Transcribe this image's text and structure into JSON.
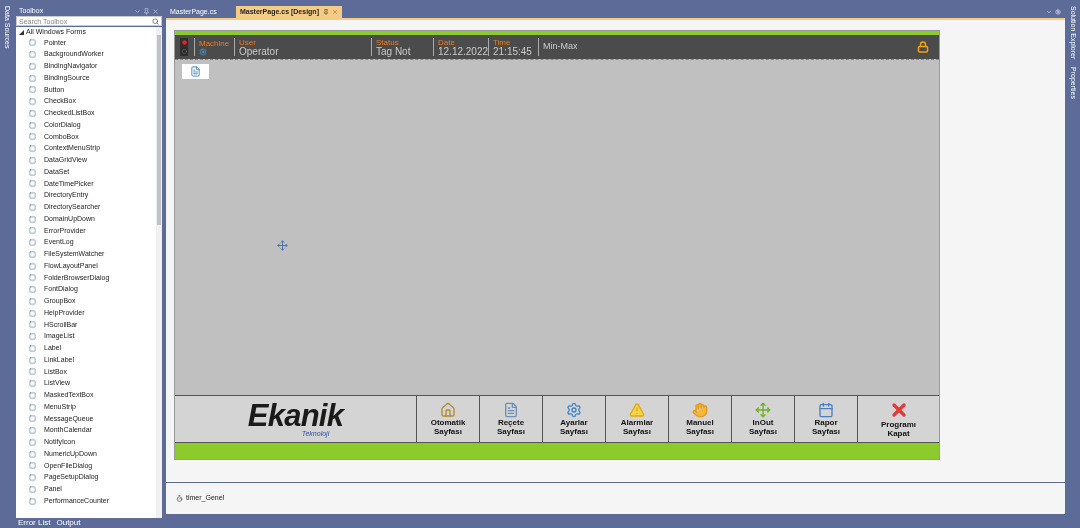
{
  "left_strip": {
    "label": "Data Sources"
  },
  "toolbox": {
    "title": "Toolbox",
    "search_placeholder": "Search Toolbox",
    "category": {
      "label": "All Windows Forms",
      "expanded": true
    },
    "items": [
      "Pointer",
      "BackgroundWorker",
      "BindingNavigator",
      "BindingSource",
      "Button",
      "CheckBox",
      "CheckedListBox",
      "ColorDialog",
      "ComboBox",
      "ContextMenuStrip",
      "DataGridView",
      "DataSet",
      "DateTimePicker",
      "DirectoryEntry",
      "DirectorySearcher",
      "DomainUpDown",
      "ErrorProvider",
      "EventLog",
      "FileSystemWatcher",
      "FlowLayoutPanel",
      "FolderBrowserDialog",
      "FontDialog",
      "GroupBox",
      "HelpProvider",
      "HScrollBar",
      "ImageList",
      "Label",
      "LinkLabel",
      "ListBox",
      "ListView",
      "MaskedTextBox",
      "MenuStrip",
      "MessageQueue",
      "MonthCalendar",
      "NotifyIcon",
      "NumericUpDown",
      "OpenFileDialog",
      "PageSetupDialog",
      "Panel",
      "PerformanceCounter"
    ]
  },
  "tabs": [
    {
      "label": "MasterPage.cs",
      "selected": false
    },
    {
      "label": "MasterPage.cs [Design]",
      "selected": true
    }
  ],
  "form": {
    "header": [
      {
        "kind": "icon",
        "label": "Machine"
      },
      {
        "kind": "text",
        "label": "User",
        "value": "Operator"
      },
      {
        "kind": "text",
        "label": "Status",
        "value": "Tag Not"
      },
      {
        "kind": "text",
        "label": "Date",
        "value": "12.12.2022"
      },
      {
        "kind": "text",
        "label": "Time",
        "value": "21:15:45"
      },
      {
        "kind": "plain",
        "value": "Min-Max"
      }
    ],
    "logo": {
      "name": "Ekanik",
      "tagline": "Teknoloji"
    },
    "nav": [
      {
        "kind": "home",
        "label": "Otomatik\nSayfası"
      },
      {
        "kind": "recipe",
        "label": "Reçete\nSayfası"
      },
      {
        "kind": "settings",
        "label": "Ayarlar\nSayfası"
      },
      {
        "kind": "alarm",
        "label": "Alarmlar\nSayfası"
      },
      {
        "kind": "hand",
        "label": "Manuel\nSayfası"
      },
      {
        "kind": "inout",
        "label": "InOut\nSayfası"
      },
      {
        "kind": "report",
        "label": "Rapor\nSayfası"
      },
      {
        "kind": "close",
        "label": "Programı\nKapat"
      }
    ]
  },
  "tray": [
    {
      "label": "timer_Genel"
    }
  ],
  "right_strip": [
    "Solution Explorer",
    "Properties"
  ],
  "bottom_tabs": [
    "Error List",
    "Output"
  ]
}
